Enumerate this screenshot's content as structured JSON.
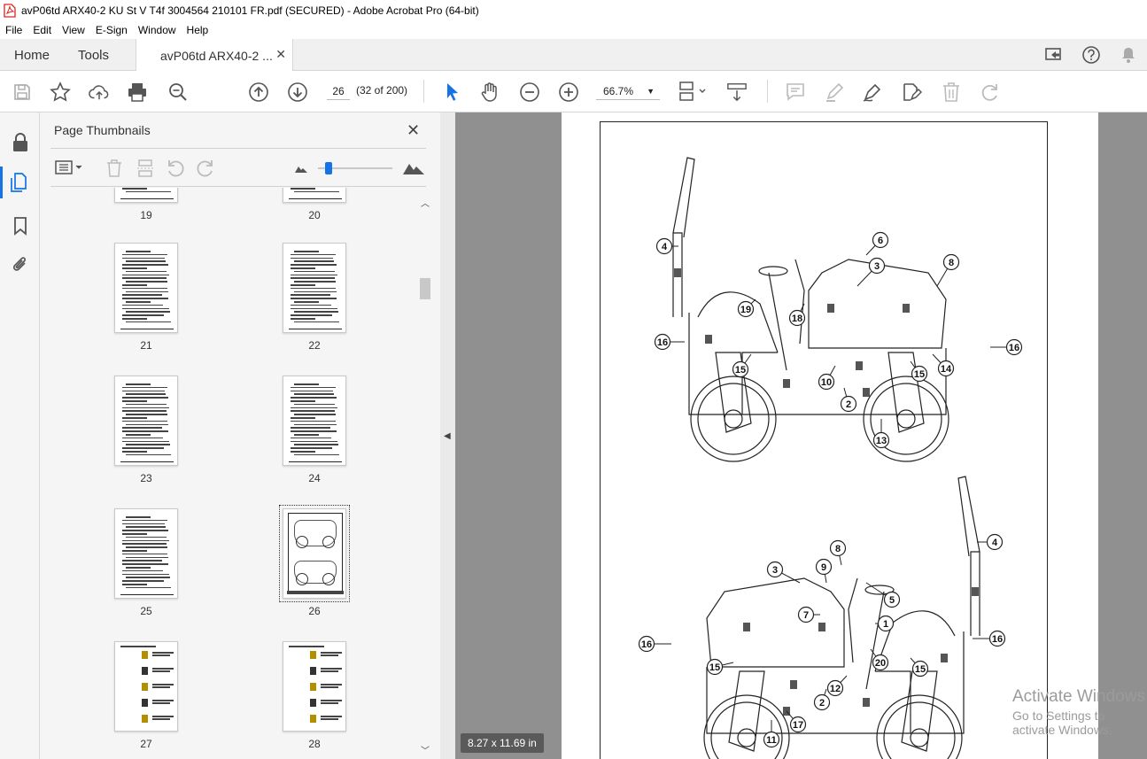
{
  "window": {
    "title": "avP06td ARX40-2 KU St V T4f 3004564 210101 FR.pdf (SECURED) - Adobe Acrobat Pro (64-bit)"
  },
  "menu": [
    "File",
    "Edit",
    "View",
    "E-Sign",
    "Window",
    "Help"
  ],
  "tabs": {
    "home": "Home",
    "tools": "Tools",
    "document": "avP06td ARX40-2 ..."
  },
  "toolbar": {
    "page_number": "26",
    "page_count": "(32 of 200)",
    "zoom": "66.7%"
  },
  "thumbnail_panel": {
    "title": "Page Thumbnails",
    "items": [
      {
        "label": "19",
        "kind": "partial"
      },
      {
        "label": "20",
        "kind": "partial"
      },
      {
        "label": "21",
        "kind": "text"
      },
      {
        "label": "22",
        "kind": "text"
      },
      {
        "label": "23",
        "kind": "text"
      },
      {
        "label": "24",
        "kind": "text"
      },
      {
        "label": "25",
        "kind": "text"
      },
      {
        "label": "26",
        "kind": "drawing",
        "selected": true
      },
      {
        "label": "27",
        "kind": "labels"
      },
      {
        "label": "28",
        "kind": "labels"
      }
    ]
  },
  "document": {
    "page_size": "8.27 x 11.69 in",
    "top_callouts": [
      "4",
      "6",
      "3",
      "8",
      "19",
      "18",
      "16",
      "16",
      "15",
      "14",
      "15",
      "10",
      "2",
      "13"
    ],
    "bottom_callouts": [
      "4",
      "8",
      "3",
      "9",
      "5",
      "7",
      "1",
      "16",
      "16",
      "15",
      "20",
      "15",
      "12",
      "2",
      "11",
      "17"
    ]
  },
  "watermark": {
    "line1": "Activate Windows",
    "line2": "Go to Settings to activate Windows."
  },
  "colors": {
    "accent": "#1473e6",
    "document_bg": "#909090",
    "panel_bg": "#f5f5f5",
    "pdf_red": "#d7261f"
  }
}
